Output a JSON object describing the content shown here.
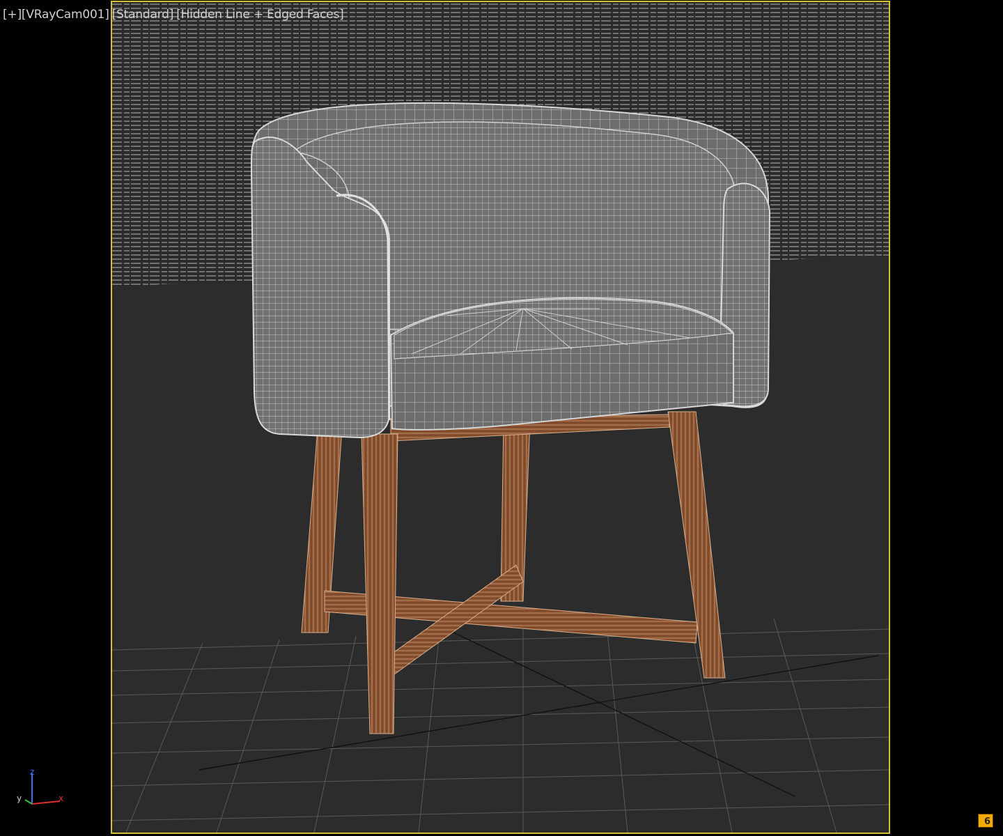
{
  "viewport": {
    "label_plus": "[+]",
    "label_camera": "[VRayCam001]",
    "label_standard": "[Standard]",
    "label_shading": "[Hidden Line + Edged Faces]"
  },
  "axis_gizmo": {
    "z_label": "z",
    "y_label": "y",
    "x_label": "x"
  },
  "status_badge": {
    "value": "6"
  },
  "colors": {
    "frame_border": "#d6c23a",
    "background_floor": "#2b2b2b",
    "wall_lines": "#a8a8a8",
    "chair_mesh": "#8a8a8a",
    "chair_wire": "#c8c8c8",
    "wood": "#8a5230",
    "badge": "#f2a900"
  }
}
